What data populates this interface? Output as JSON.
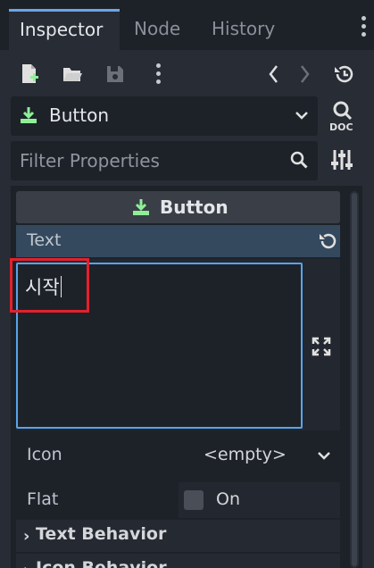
{
  "tabs": [
    {
      "label": "Inspector",
      "active": true
    },
    {
      "label": "Node",
      "active": false
    },
    {
      "label": "History",
      "active": false
    }
  ],
  "toolbar": {
    "icons": [
      "new-resource-icon",
      "open-folder-icon",
      "save-icon",
      "more-icon",
      "back-icon",
      "forward-icon",
      "history-icon"
    ]
  },
  "node_selector": {
    "name": "Button",
    "icon": "button-node-icon"
  },
  "filter": {
    "placeholder": "Filter Properties"
  },
  "section": {
    "title": "Button"
  },
  "properties": {
    "text": {
      "label": "Text",
      "value": "시작"
    },
    "icon": {
      "label": "Icon",
      "value": "<empty>"
    },
    "flat": {
      "label": "Flat",
      "checkbox_label": "On",
      "checked": false
    }
  },
  "groups": [
    {
      "label": "Text Behavior"
    },
    {
      "label": "Icon Behavior"
    }
  ],
  "colors": {
    "accent": "#6aa7e6",
    "node_icon": "#8eef97",
    "highlight": "#e3212b",
    "selected_property": "#34495e"
  }
}
